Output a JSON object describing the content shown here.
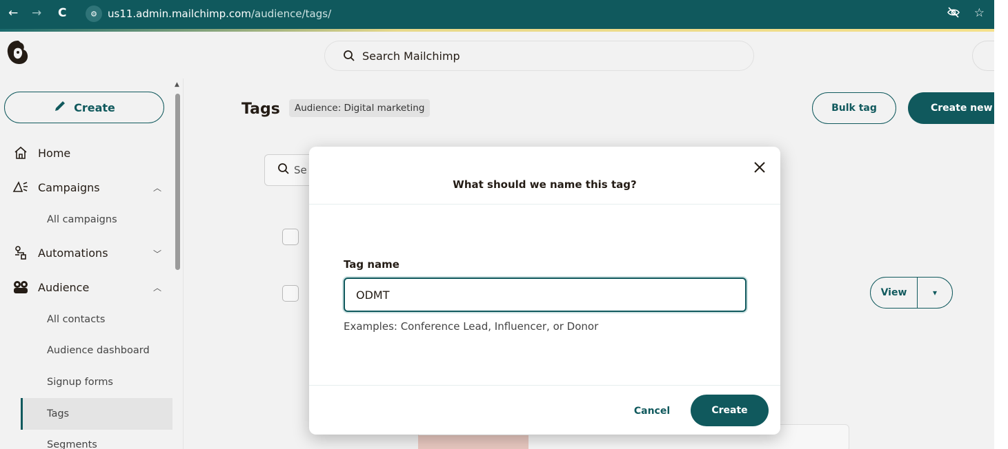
{
  "browser": {
    "url_host": "us11.admin.mailchimp.com",
    "url_path": "/audience/tags/"
  },
  "topbar": {
    "search_placeholder": "Search Mailchimp"
  },
  "sidebar": {
    "create_label": "Create",
    "items": [
      {
        "label": "Home"
      },
      {
        "label": "Campaigns"
      },
      {
        "label": "All campaigns"
      },
      {
        "label": "Automations"
      },
      {
        "label": "Audience"
      },
      {
        "label": "All contacts"
      },
      {
        "label": "Audience dashboard"
      },
      {
        "label": "Signup forms"
      },
      {
        "label": "Tags"
      },
      {
        "label": "Segments"
      }
    ]
  },
  "main": {
    "title": "Tags",
    "audience_badge": "Audience: Digital marketing",
    "bulk_tag_label": "Bulk tag",
    "create_new_label": "Create new ta",
    "search_partial": "Se",
    "view_label": "View"
  },
  "modal": {
    "title": "What should we name this tag?",
    "field_label": "Tag name",
    "field_value": "ODMT",
    "help_text": "Examples: Conference Lead, Influencer, or Donor",
    "cancel_label": "Cancel",
    "create_label": "Create"
  },
  "colors": {
    "brand_teal": "#10595d",
    "background": "#f2f2f2"
  }
}
